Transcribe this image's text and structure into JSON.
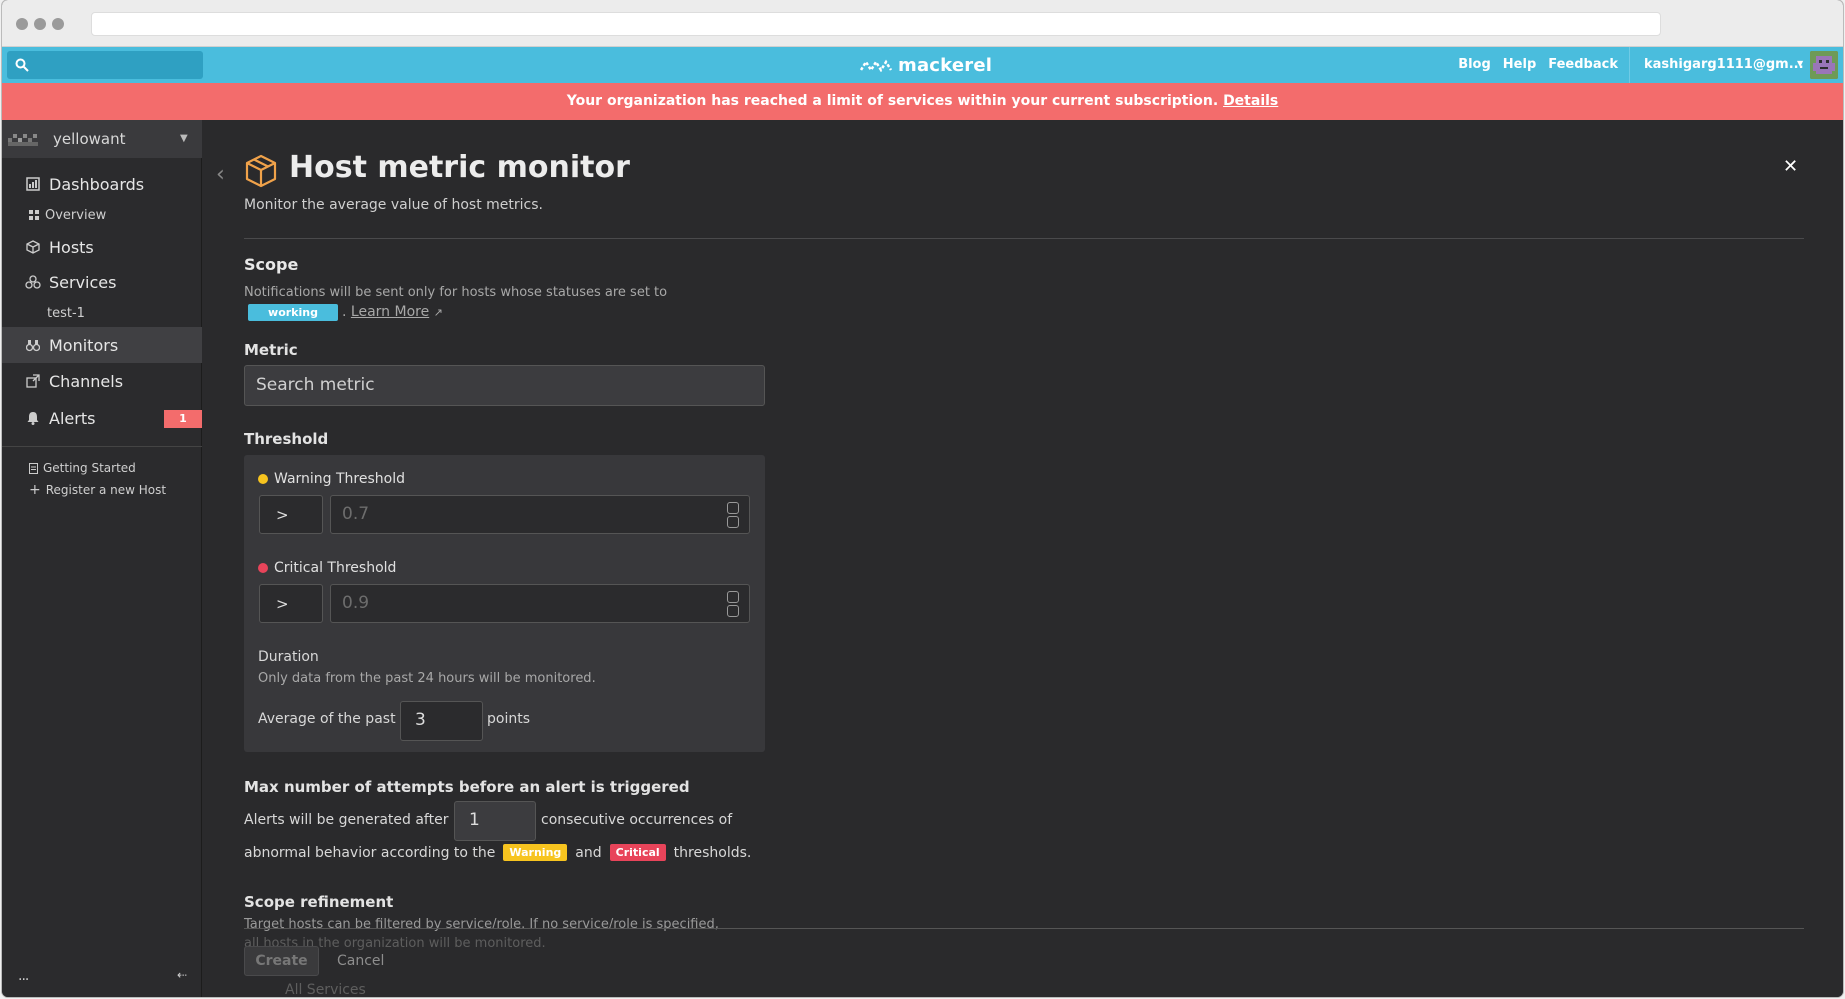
{
  "topbar": {
    "logo": "mackerel",
    "links": [
      "Blog",
      "Help",
      "Feedback"
    ],
    "account": "kashigarg1111@gm..."
  },
  "banner": {
    "text": "Your organization has reached a limit of services within your current subscription.",
    "link": "Details"
  },
  "sidebar": {
    "org": "yellowant",
    "items": [
      {
        "label": "Dashboards",
        "icon": "dashboard-icon"
      },
      {
        "label": "Overview",
        "icon": "grid-icon"
      },
      {
        "label": "Hosts",
        "icon": "cube-icon"
      },
      {
        "label": "Services",
        "icon": "services-icon"
      },
      {
        "label": "test-1"
      },
      {
        "label": "Monitors",
        "icon": "binoculars-icon"
      },
      {
        "label": "Channels",
        "icon": "channel-icon"
      },
      {
        "label": "Alerts",
        "icon": "bell-icon",
        "badge": "1"
      }
    ],
    "links": [
      "Getting Started",
      "Register a new Host"
    ],
    "footer_dots": "...",
    "footer_arrow": "⇠"
  },
  "main": {
    "title": "Host metric monitor",
    "subtitle": "Monitor the average value of host metrics.",
    "scope": {
      "heading": "Scope",
      "desc": "Notifications will be sent only for hosts whose statuses are set to",
      "tag": "working",
      "learn_more": "Learn More"
    },
    "metric": {
      "heading": "Metric",
      "placeholder": "Search metric"
    },
    "threshold": {
      "heading": "Threshold",
      "warning_label": "Warning Threshold",
      "warning_op": ">",
      "warning_value": "0.7",
      "critical_label": "Critical Threshold",
      "critical_op": ">",
      "critical_value": "0.9",
      "duration_label": "Duration",
      "duration_desc": "Only data from the past 24 hours will be monitored.",
      "avg_prefix": "Average of the past",
      "avg_value": "3",
      "avg_suffix": "points"
    },
    "attempts": {
      "heading": "Max number of attempts before an alert is triggered",
      "line1_prefix": "Alerts will be generated after",
      "value": "1",
      "line1_suffix": "consecutive occurrences of",
      "line2_prefix": "abnormal behavior according to the",
      "warning": "Warning",
      "and": "and",
      "critical": "Critical",
      "line2_suffix": "thresholds."
    },
    "refinement": {
      "heading": "Scope refinement",
      "line1": "Target hosts can be filtered by service/role. If no service/role is specified,",
      "line2": "all hosts in the organization will be monitored.",
      "all_services": "All Services"
    },
    "buttons": {
      "create": "Create",
      "cancel": "Cancel"
    }
  },
  "colors": {
    "topbar": "#4abddd",
    "banner": "#f36c6c",
    "warning": "#f7c41f",
    "critical": "#e8445a",
    "background": "#2a2a2c"
  }
}
